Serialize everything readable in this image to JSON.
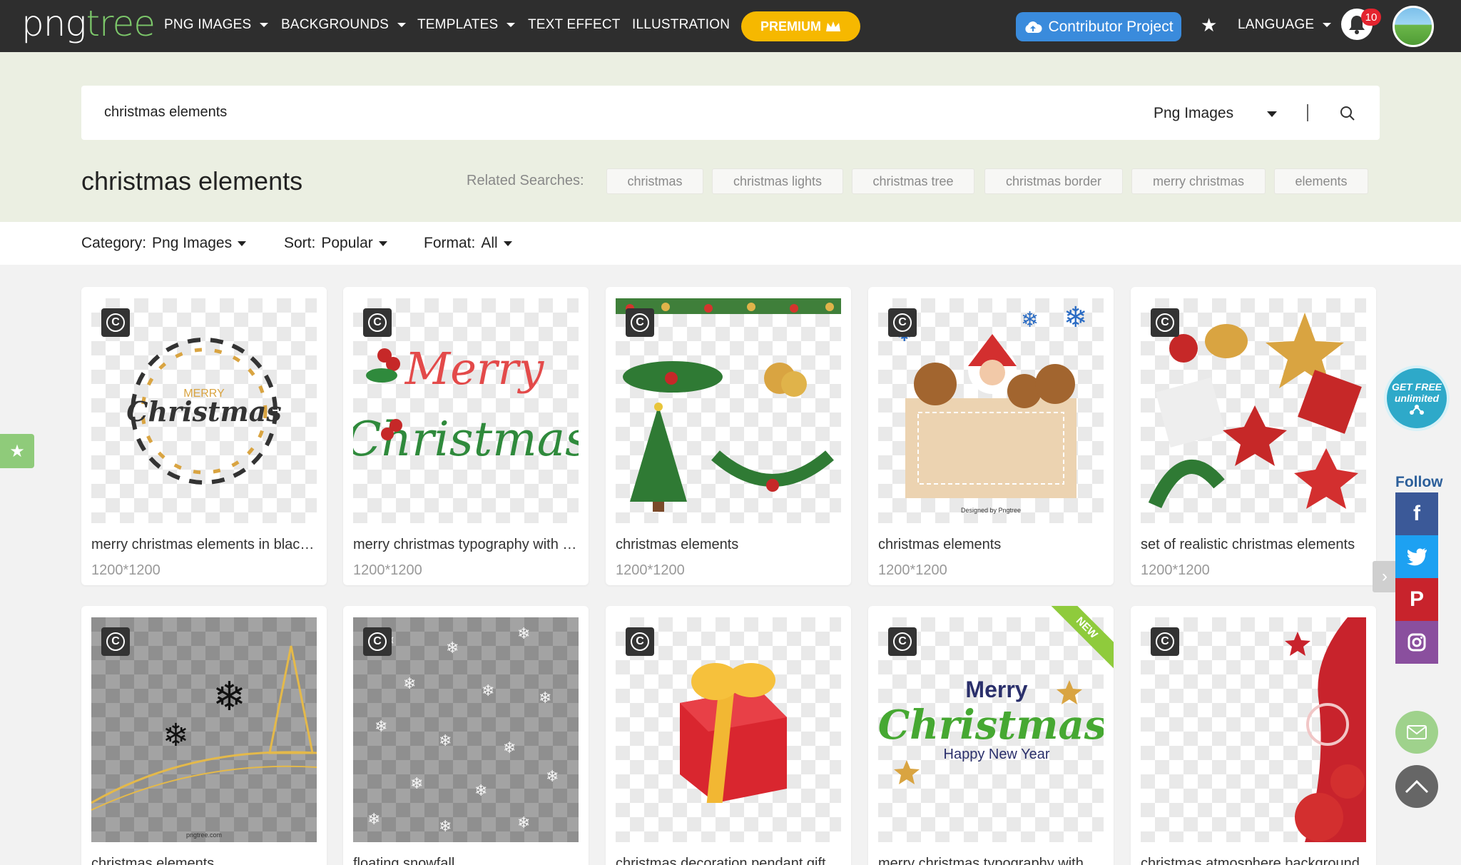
{
  "logo": {
    "part1": "png",
    "part2": "tree"
  },
  "nav": {
    "png_images": "PNG IMAGES",
    "backgrounds": "BACKGROUNDS",
    "templates": "TEMPLATES",
    "text_effect": "TEXT EFFECT",
    "illustration": "ILLUSTRATION",
    "premium": "PREMIUM",
    "contributor": "Contributor Project",
    "language": "LANGUAGE",
    "notifications": "10"
  },
  "search": {
    "value": "christmas elements",
    "category": "Png Images"
  },
  "page_title": "christmas elements",
  "related": {
    "label": "Related Searches:",
    "tags": [
      "christmas",
      "christmas lights",
      "christmas tree",
      "christmas border",
      "merry christmas",
      "elements"
    ]
  },
  "filters": {
    "category_label": "Category:",
    "category_value": "Png Images",
    "sort_label": "Sort:",
    "sort_value": "Popular",
    "format_label": "Format:",
    "format_value": "All"
  },
  "cards": [
    {
      "title": "merry christmas elements in black and gold",
      "size": "1200*1200"
    },
    {
      "title": "merry christmas typography with holly",
      "size": "1200*1200"
    },
    {
      "title": "christmas elements",
      "size": "1200*1200"
    },
    {
      "title": "christmas elements",
      "size": "1200*1200"
    },
    {
      "title": "set of realistic christmas elements",
      "size": "1200*1200"
    },
    {
      "title": "christmas elements"
    },
    {
      "title": "floating snowfall"
    },
    {
      "title": "christmas decoration pendant gift box"
    },
    {
      "title": "merry christmas typography with stars"
    },
    {
      "title": "christmas atmosphere background"
    }
  ],
  "badges": {
    "new": "NEW"
  },
  "thumb_text": {
    "merry": "MERRY",
    "christmas": "Christmas",
    "merry_script": "Merry",
    "christmas_script": "Christmas",
    "designed_by": "Designed by Pngtree",
    "merry_bold": "Merry",
    "christmas_green": "Christmas",
    "happy_new_year": "Happy New Year",
    "pngtree_com": "pngtree.com"
  },
  "sidebar": {
    "get_free_1": "GET FREE",
    "get_free_2": "unlimited",
    "follow": "Follow"
  },
  "colors": {
    "topnav": "#2e2e2e",
    "premium": "#f6b800",
    "contributor": "#3a8bdc",
    "banner": "#ebefe2",
    "facebook": "#3b5998",
    "twitter": "#1da1f2",
    "pinterest": "#c8232c",
    "instagram": "#8a4f9e"
  }
}
